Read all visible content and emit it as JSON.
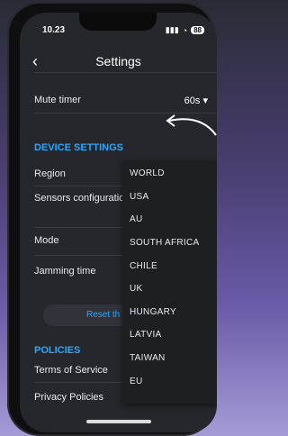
{
  "status_bar": {
    "time": "10.23",
    "battery": "88"
  },
  "header": {
    "back_icon": "chevron-left-icon",
    "title": "Settings"
  },
  "settings": {
    "mute_timer": {
      "label": "Mute timer",
      "value": "60s"
    },
    "device_section": "DEVICE SETTINGS",
    "region_label": "Region",
    "sensors_label": "Sensors configuration",
    "mode_label": "Mode",
    "jamming_label": "Jamming time",
    "reset_label": "Reset th",
    "policies_section": "POLICIES",
    "terms_label": "Terms of Service",
    "privacy_label": "Privacy Policies"
  },
  "region_dropdown": {
    "options": [
      "WORLD",
      "USA",
      "AU",
      "SOUTH AFRICA",
      "CHILE",
      "UK",
      "HUNGARY",
      "LATVIA",
      "TAIWAN",
      "EU"
    ]
  },
  "colors": {
    "accent": "#2aa7ff",
    "background": "#26272c"
  }
}
